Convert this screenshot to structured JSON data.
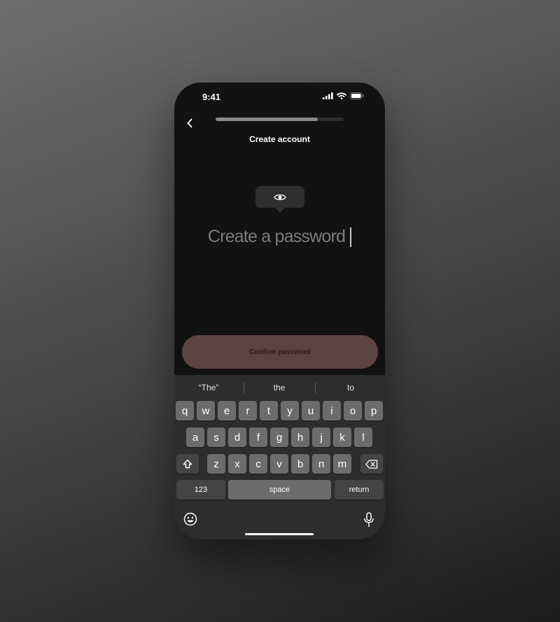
{
  "status_bar": {
    "time": "9:41"
  },
  "header": {
    "title": "Create account",
    "progress": 0.8
  },
  "password": {
    "placeholder": "Create a password"
  },
  "confirm_button": {
    "label": "Confirm password"
  },
  "keyboard": {
    "suggestions": [
      "“The”",
      "the",
      "to"
    ],
    "row1": [
      "q",
      "w",
      "e",
      "r",
      "t",
      "y",
      "u",
      "i",
      "o",
      "p"
    ],
    "row2": [
      "a",
      "s",
      "d",
      "f",
      "g",
      "h",
      "j",
      "k",
      "l"
    ],
    "row3": [
      "z",
      "x",
      "c",
      "v",
      "b",
      "n",
      "m"
    ],
    "numbers_label": "123",
    "space_label": "space",
    "return_label": "return"
  },
  "icons": {
    "back": "chevron-left-icon",
    "reveal": "eye-icon",
    "shift": "shift-icon",
    "delete": "backspace-icon",
    "emoji": "emoji-icon",
    "mic": "microphone-icon"
  },
  "colors": {
    "confirm_button_bg": "#5b4442",
    "screen_bg": "#131212",
    "keyboard_bg": "#2d2d2d"
  }
}
